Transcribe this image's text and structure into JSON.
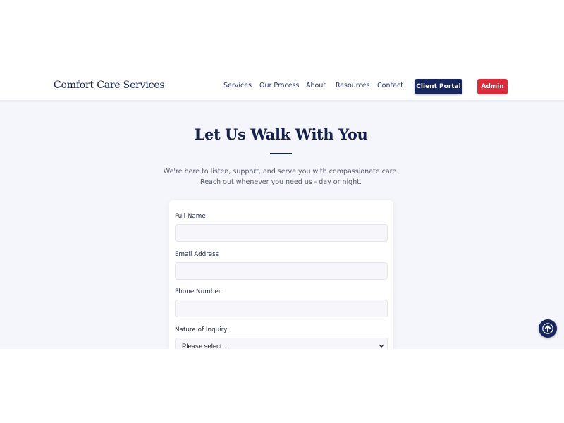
{
  "navbar": {
    "brand": "Comfort Care Services",
    "links": [
      "Services",
      "Our Process",
      "About",
      "Resources",
      "Contact"
    ],
    "portal_label": "Client Portal",
    "admin_label": "Admin"
  },
  "hero": {
    "title": "Let Us Walk With You",
    "subtitle_line1": "We're here to listen, support, and serve you with compassionate care.",
    "subtitle_line2": "Reach out whenever you need us - day or night."
  },
  "form": {
    "full_name": {
      "label": "Full Name",
      "value": "",
      "placeholder": ""
    },
    "email": {
      "label": "Email Address",
      "value": "",
      "placeholder": ""
    },
    "phone": {
      "label": "Phone Number",
      "value": "",
      "placeholder": ""
    },
    "inquiry": {
      "label": "Nature of Inquiry",
      "selected": "Please select..."
    }
  },
  "icons": {
    "select_chevron": "chevron-down-icon",
    "scroll_top": "arrow-up-icon"
  },
  "colors": {
    "brand_navy": "#17275e",
    "admin_red": "#dc2b3b",
    "page_background": "#f5f6fb"
  }
}
